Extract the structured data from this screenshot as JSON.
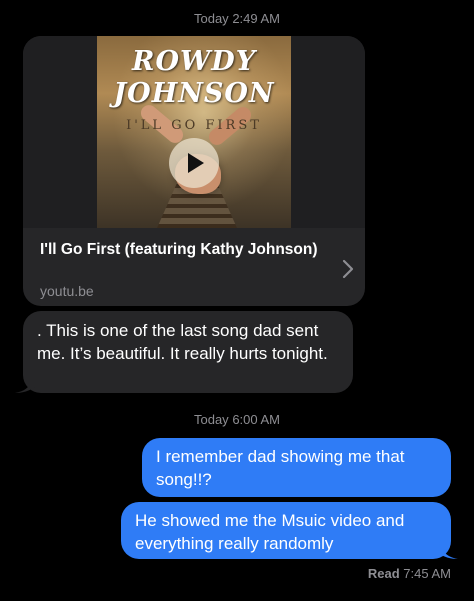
{
  "timestamps": {
    "first": {
      "day": "Today",
      "time": "2:49 AM"
    },
    "second": {
      "day": "Today",
      "time": "6:00 AM"
    }
  },
  "link_preview": {
    "title": "I'll Go First (featuring Kathy Johnson)",
    "domain": "youtu.be",
    "thumbnail_text": {
      "line1": "ROWDY",
      "line2": "JOHNSON",
      "line3": "I'LL GO FIRST"
    },
    "play_icon": "play-icon",
    "chevron_icon": "chevron-right-icon"
  },
  "messages": [
    {
      "direction": "incoming",
      "text": ".  This is one of the last song dad sent me. It’s beautiful. It really hurts tonight."
    },
    {
      "direction": "outgoing",
      "text": "I remember dad showing me that song!!?"
    },
    {
      "direction": "outgoing",
      "text": "He showed me the Msuic video and everything really randomly"
    }
  ],
  "read_receipt": {
    "label": "Read",
    "time": "7:45 AM"
  },
  "colors": {
    "background": "#000000",
    "incoming_bubble": "#262628",
    "outgoing_bubble": "#2f7cf6",
    "meta_text": "#8e8e93"
  }
}
